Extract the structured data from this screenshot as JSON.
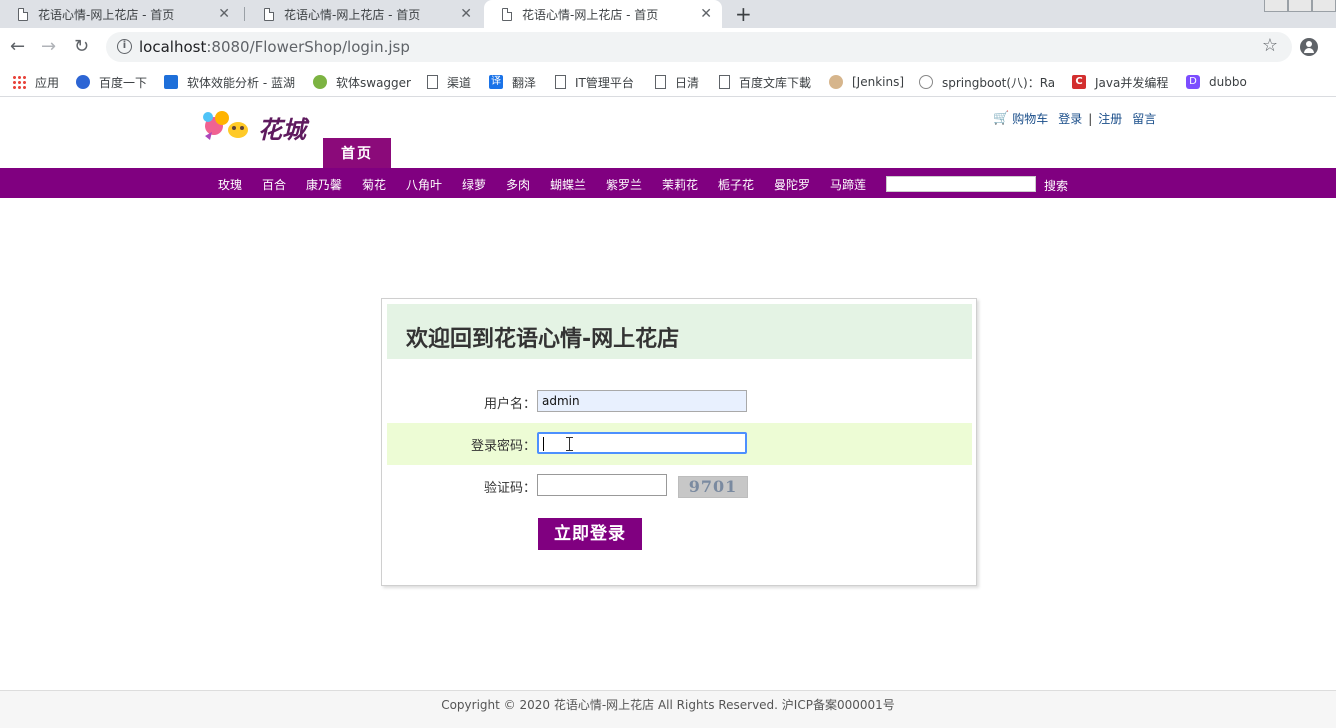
{
  "browser": {
    "tabs": [
      {
        "title": "花语心情-网上花店 - 首页"
      },
      {
        "title": "花语心情-网上花店 - 首页"
      },
      {
        "title": "花语心情-网上花店 - 首页"
      }
    ],
    "new_tab": "+",
    "close_glyph": "✕",
    "url_host": "localhost",
    "url_path": ":8080/FlowerShop/login.jsp",
    "bookmarks": [
      {
        "label": "应用",
        "icon": "apps-grid-icon"
      },
      {
        "label": "百度一下",
        "icon": "baidu-paw-icon"
      },
      {
        "label": "软体效能分析 - 蓝湖",
        "icon": "lanhu-icon"
      },
      {
        "label": "软体swagger",
        "icon": "swagger-icon"
      },
      {
        "label": "渠道",
        "icon": "page-icon"
      },
      {
        "label": "翻泽",
        "icon": "translate-icon"
      },
      {
        "label": "IT管理平台",
        "icon": "page-icon"
      },
      {
        "label": "日清",
        "icon": "page-icon"
      },
      {
        "label": "百度文库下載",
        "icon": "page-icon"
      },
      {
        "label": "[Jenkins]",
        "icon": "jenkins-icon"
      },
      {
        "label": "springboot(八)：Ra",
        "icon": "spring-icon"
      },
      {
        "label": "Java并发编程",
        "icon": "csdn-icon"
      },
      {
        "label": "dubbo",
        "icon": "dubbo-icon"
      }
    ]
  },
  "header": {
    "cart": "购物车",
    "login": "登录",
    "separator": "|",
    "register": "注册",
    "message": "留言",
    "home_tab": "首页"
  },
  "categories": [
    "玫瑰",
    "百合",
    "康乃馨",
    "菊花",
    "八角叶",
    "绿萝",
    "多肉",
    "蝴蝶兰",
    "紫罗兰",
    "茉莉花",
    "栀子花",
    "曼陀罗",
    "马蹄莲"
  ],
  "search": {
    "button": "搜索",
    "value": ""
  },
  "login": {
    "title": "欢迎回到花语心情-网上花店",
    "username_label": "用户名：",
    "username_value": "admin",
    "password_label": "登录密码：",
    "captcha_label": "验证码：",
    "captcha_text": "9701",
    "submit": "立即登录"
  },
  "footer": {
    "text": "Copyright © 2020 花语心情-网上花店 All Rights Reserved. 沪ICP备案000001号"
  },
  "colors": {
    "brand_purple": "#800080",
    "header_green": "#e4f3e4",
    "row_highlight": "#edfcd5"
  }
}
